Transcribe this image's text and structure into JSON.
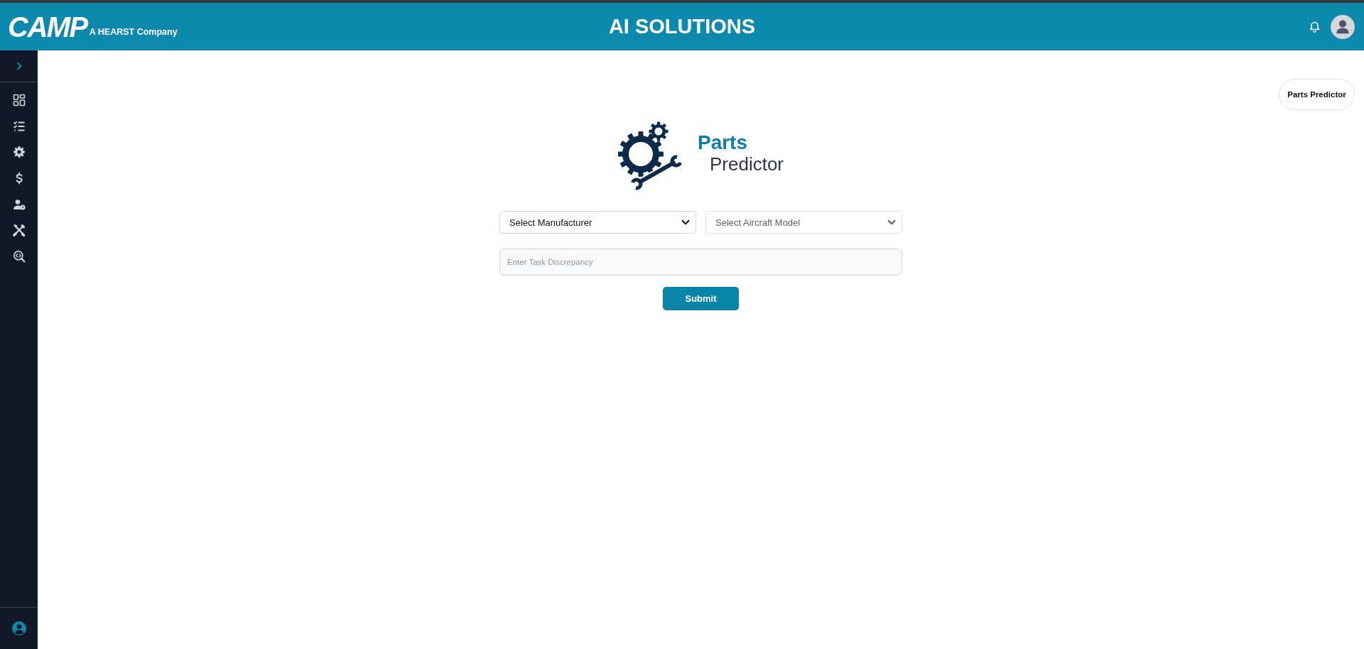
{
  "header": {
    "logo": {
      "wordmark": "CAMP",
      "tagline": "A HEARST Company"
    },
    "title": "AI SOLUTIONS"
  },
  "sidebar": {
    "expanded": false,
    "items": [
      {
        "kind": "dashboard"
      },
      {
        "kind": "checklist"
      },
      {
        "kind": "settings"
      },
      {
        "kind": "billing"
      },
      {
        "kind": "user-schedule"
      },
      {
        "kind": "tools"
      },
      {
        "kind": "code-search"
      }
    ]
  },
  "page_chip": {
    "label": "Parts Predictor"
  },
  "app_logo": {
    "title": "Parts",
    "subtitle": "Predictor"
  },
  "form": {
    "selects": [
      {
        "value": "Select Manufacturer",
        "disabled": false
      },
      {
        "value": "Select Aircraft Model",
        "disabled": true
      }
    ],
    "task_discrepancy": {
      "placeholder": "Enter Task Discrepancy"
    },
    "submit_button": {
      "label": "Submit"
    }
  }
}
